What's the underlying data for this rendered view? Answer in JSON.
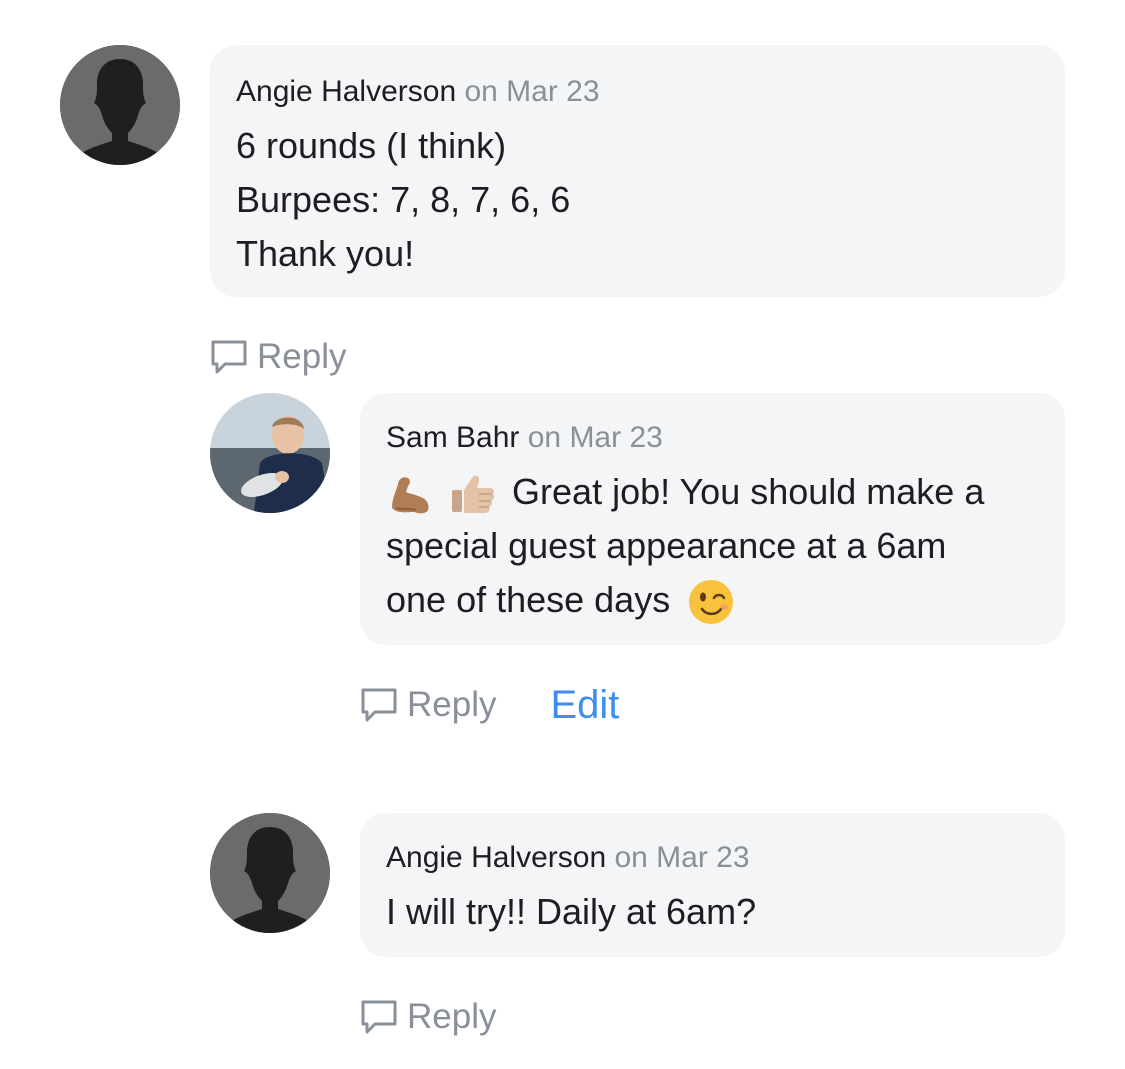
{
  "comments": [
    {
      "author": "Angie Halverson",
      "date": "on Mar 23",
      "lines": [
        "6 rounds (I think)",
        "Burpees: 7, 8, 7, 6, 6",
        "Thank you!"
      ],
      "reply_label": "Reply",
      "avatar": "default-user-icon"
    },
    {
      "author": "Sam Bahr",
      "date": "on Mar 23",
      "line1_text": "Great job! You should make a",
      "line2": "special guest appearance at a 6am",
      "line3_text": "one of these days",
      "emojis": [
        "flexed-biceps-emoji",
        "thumbs-up-emoji",
        "winking-face-emoji"
      ],
      "reply_label": "Reply",
      "edit_label": "Edit",
      "avatar": "user-photo"
    },
    {
      "author": "Angie Halverson",
      "date": "on Mar 23",
      "lines": [
        "I will try!! Daily at 6am?"
      ],
      "reply_label": "Reply",
      "avatar": "default-user-icon"
    }
  ],
  "colors": {
    "bubble_bg": "#f4f5f7",
    "muted_text": "#8a9099",
    "edit_link": "#3d8ef0",
    "default_avatar_bg": "#6b6b6b"
  }
}
